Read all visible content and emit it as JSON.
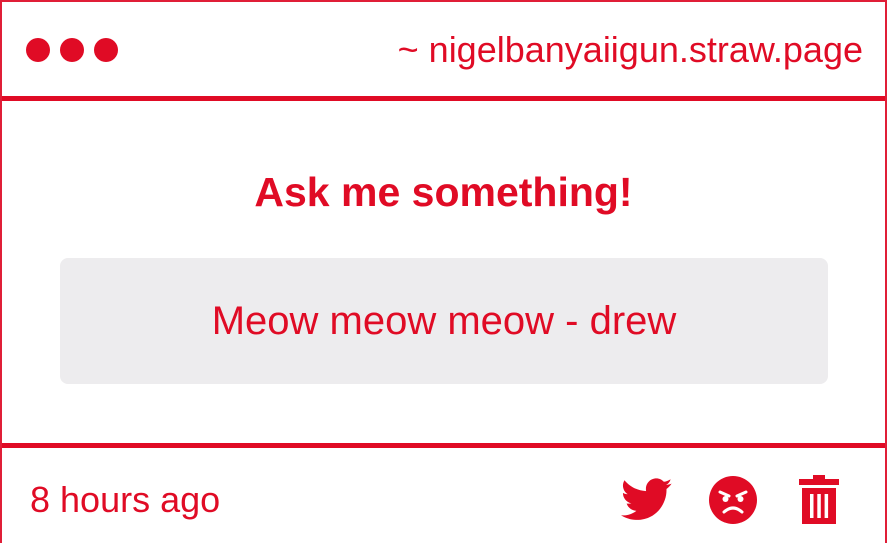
{
  "titlebar": {
    "url": "~ nigelbanyaiigun.straw.page"
  },
  "main": {
    "prompt": "Ask me something!",
    "answer": "Meow meow meow - drew"
  },
  "footer": {
    "timestamp": "8 hours ago",
    "icons": [
      "twitter-icon",
      "angry-face-icon",
      "trash-icon"
    ]
  },
  "colors": {
    "accent": "#e00b25",
    "answer_bg": "#edecee"
  }
}
